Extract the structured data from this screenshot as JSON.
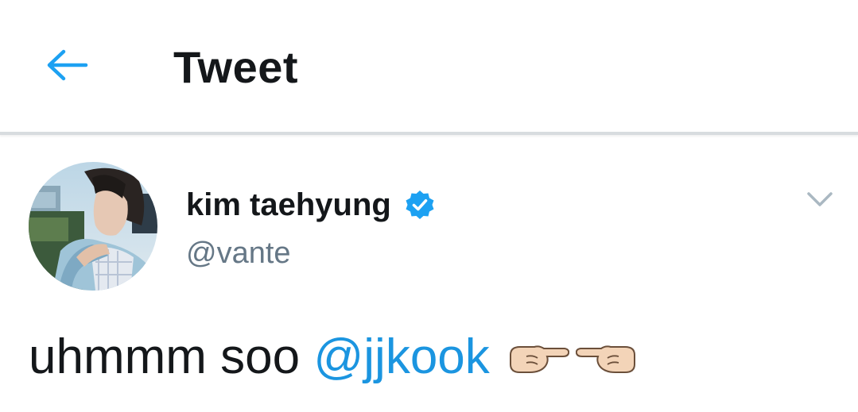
{
  "header": {
    "back_icon": "arrow-left-icon",
    "title": "Tweet"
  },
  "tweet": {
    "author": {
      "display_name": "kim taehyung",
      "handle": "@vante",
      "verified": true,
      "verified_icon": "verified-badge-icon"
    },
    "menu_icon": "chevron-down-icon",
    "text_before": "uhmmm soo ",
    "mention": "@jjkook",
    "emojis": [
      "pointing-right-hand-icon",
      "pointing-left-hand-icon"
    ]
  },
  "colors": {
    "accent": "#1da1f2",
    "link": "#1b95e0",
    "text": "#14171a",
    "secondary": "#657786"
  }
}
